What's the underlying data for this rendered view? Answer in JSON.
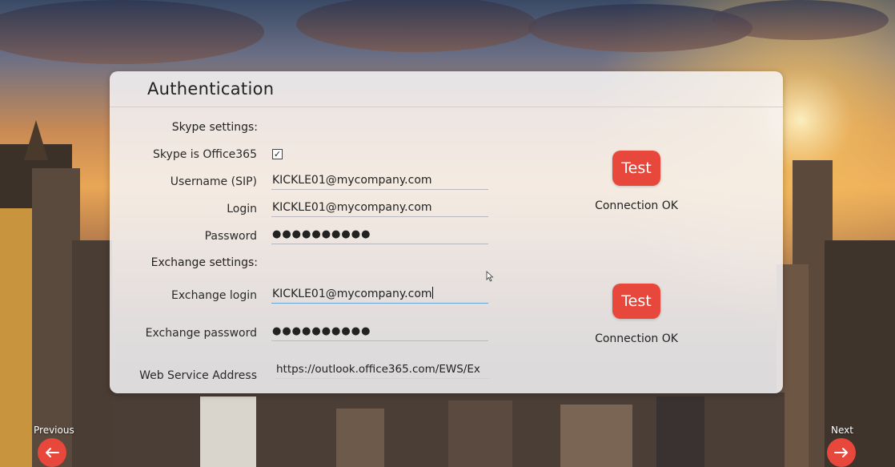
{
  "panel": {
    "title": "Authentication"
  },
  "skype": {
    "section_label": "Skype settings:",
    "office365_label": "Skype is Office365",
    "office365_checked": true,
    "office365_mark": "✓",
    "username_label": "Username (SIP)",
    "username_value": "KICKLE01@mycompany.com",
    "login_label": "Login",
    "login_value": "KICKLE01@mycompany.com",
    "password_label": "Password",
    "password_value": "●●●●●●●●●●",
    "test_label": "Test",
    "status": "Connection OK"
  },
  "exchange": {
    "section_label": "Exchange settings:",
    "login_label": "Exchange login",
    "login_value": "KICKLE01@mycompany.com",
    "password_label": "Exchange password",
    "password_value": "●●●●●●●●●●",
    "ews_label": "Web Service Address",
    "ews_value": "https://outlook.office365.com/EWS/Ex",
    "test_label": "Test",
    "status": "Connection OK"
  },
  "nav": {
    "previous_label": "Previous",
    "previous_icon": "arrow-left-icon",
    "next_label": "Next",
    "next_icon": "arrow-right-icon"
  },
  "colors": {
    "accent": "#e8483b",
    "panel": "#f6f6f8"
  }
}
